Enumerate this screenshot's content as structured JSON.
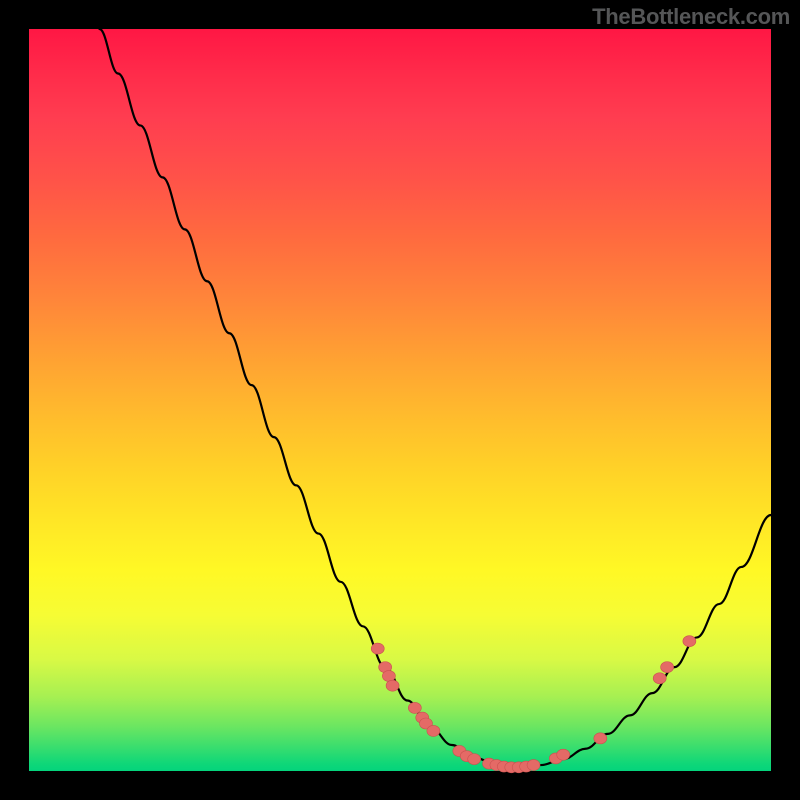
{
  "attribution": "TheBottleneck.com",
  "colors": {
    "page_bg": "#000000",
    "curve_stroke": "#000000",
    "marker_fill": "#e46a66",
    "marker_stroke": "#c9514f",
    "gradient_stops": [
      "#ff1744",
      "#ff2b4a",
      "#ff3d50",
      "#ff5249",
      "#ff6a3f",
      "#ff843a",
      "#ffa033",
      "#ffbb2d",
      "#ffd427",
      "#ffe826",
      "#fff825",
      "#f6fc34",
      "#d8f945",
      "#a6f052",
      "#6be661",
      "#35dd6f",
      "#0fd778",
      "#04d47c"
    ]
  },
  "chart_data": {
    "type": "line",
    "title": "",
    "xlabel": "",
    "ylabel": "",
    "xlim": [
      0,
      100
    ],
    "ylim": [
      0,
      100
    ],
    "curve_xy_percent": [
      [
        9.5,
        100.0
      ],
      [
        12.0,
        94.0
      ],
      [
        15.0,
        87.0
      ],
      [
        18.0,
        80.0
      ],
      [
        21.0,
        73.0
      ],
      [
        24.0,
        66.0
      ],
      [
        27.0,
        59.0
      ],
      [
        30.0,
        52.0
      ],
      [
        33.0,
        45.0
      ],
      [
        36.0,
        38.5
      ],
      [
        39.0,
        32.0
      ],
      [
        42.0,
        25.5
      ],
      [
        45.0,
        19.5
      ],
      [
        48.0,
        14.0
      ],
      [
        51.0,
        9.5
      ],
      [
        54.0,
        6.0
      ],
      [
        57.0,
        3.5
      ],
      [
        60.0,
        1.8
      ],
      [
        63.0,
        0.9
      ],
      [
        66.0,
        0.5
      ],
      [
        69.0,
        0.8
      ],
      [
        72.0,
        1.6
      ],
      [
        75.0,
        3.0
      ],
      [
        78.0,
        5.0
      ],
      [
        81.0,
        7.5
      ],
      [
        84.0,
        10.5
      ],
      [
        87.0,
        14.0
      ],
      [
        90.0,
        18.0
      ],
      [
        93.0,
        22.5
      ],
      [
        96.0,
        27.5
      ],
      [
        100.0,
        34.5
      ]
    ],
    "series": [
      {
        "name": "markers",
        "points_xy_percent": [
          [
            47.0,
            16.5
          ],
          [
            48.0,
            14.0
          ],
          [
            48.5,
            12.8
          ],
          [
            49.0,
            11.5
          ],
          [
            52.0,
            8.5
          ],
          [
            53.0,
            7.2
          ],
          [
            53.5,
            6.4
          ],
          [
            54.5,
            5.4
          ],
          [
            58.0,
            2.7
          ],
          [
            59.0,
            2.0
          ],
          [
            60.0,
            1.6
          ],
          [
            62.0,
            1.0
          ],
          [
            63.0,
            0.8
          ],
          [
            64.0,
            0.6
          ],
          [
            65.0,
            0.5
          ],
          [
            66.0,
            0.5
          ],
          [
            67.0,
            0.6
          ],
          [
            68.0,
            0.8
          ],
          [
            71.0,
            1.7
          ],
          [
            72.0,
            2.2
          ],
          [
            77.0,
            4.4
          ],
          [
            85.0,
            12.5
          ],
          [
            86.0,
            14.0
          ],
          [
            89.0,
            17.5
          ]
        ]
      }
    ]
  }
}
